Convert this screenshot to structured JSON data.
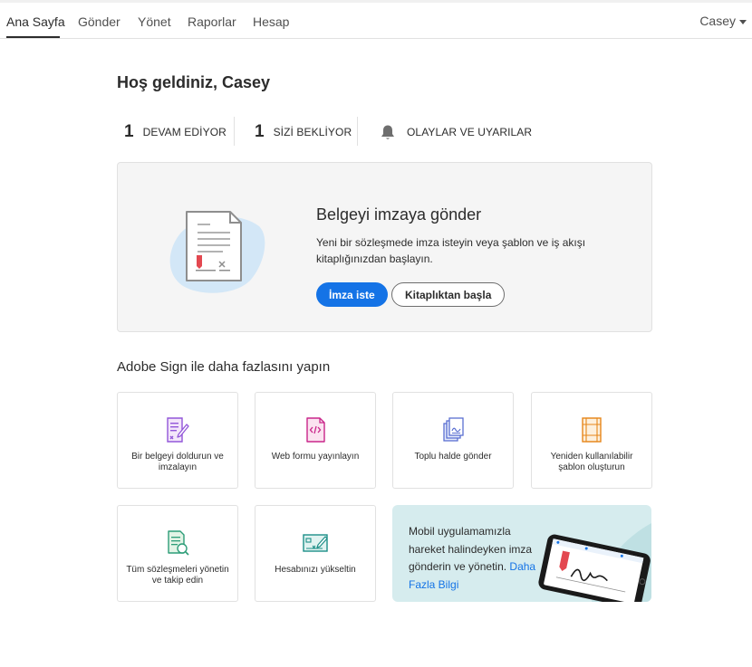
{
  "nav": {
    "items": [
      {
        "label": "Ana Sayfa"
      },
      {
        "label": "Gönder"
      },
      {
        "label": "Yönet"
      },
      {
        "label": "Raporlar"
      },
      {
        "label": "Hesap"
      }
    ],
    "user": "Casey"
  },
  "welcome": "Hoş geldiniz, Casey",
  "stats": {
    "in_progress": {
      "count": "1",
      "label": "DEVAM EDİYOR"
    },
    "waiting": {
      "count": "1",
      "label": "SİZİ BEKLİYOR"
    },
    "events": {
      "label": "OLAYLAR VE UYARILAR",
      "icon": "bell-icon"
    }
  },
  "send_card": {
    "title": "Belgeyi imzaya gönder",
    "description": "Yeni bir sözleşmede imza isteyin veya şablon ve iş akışı kitaplığınızdan başlayın.",
    "primary_button": "İmza iste",
    "secondary_button": "Kitaplıktan başla"
  },
  "more_section": {
    "title": "Adobe Sign ile daha fazlasını yapın",
    "tiles": [
      {
        "label": "Bir belgeyi doldurun ve imzalayın",
        "icon": "fill-sign-icon"
      },
      {
        "label": "Web formu yayınlayın",
        "icon": "web-form-icon"
      },
      {
        "label": "Toplu halde gönder",
        "icon": "bulk-send-icon"
      },
      {
        "label": "Yeniden kullanılabilir şablon oluşturun",
        "icon": "template-icon"
      },
      {
        "label": "Tüm sözleşmeleri yönetin ve takip edin",
        "icon": "manage-agreements-icon"
      },
      {
        "label": "Hesabınızı yükseltin",
        "icon": "upgrade-account-icon"
      }
    ]
  },
  "promo": {
    "text": "Mobil uygulamamızla hareket halindeyken imza gönderin ve yönetin.",
    "link": "Daha Fazla Bilgi"
  },
  "colors": {
    "accent": "#1473e6",
    "card_bg": "#f5f5f5",
    "promo_bg": "#d6ecee"
  }
}
